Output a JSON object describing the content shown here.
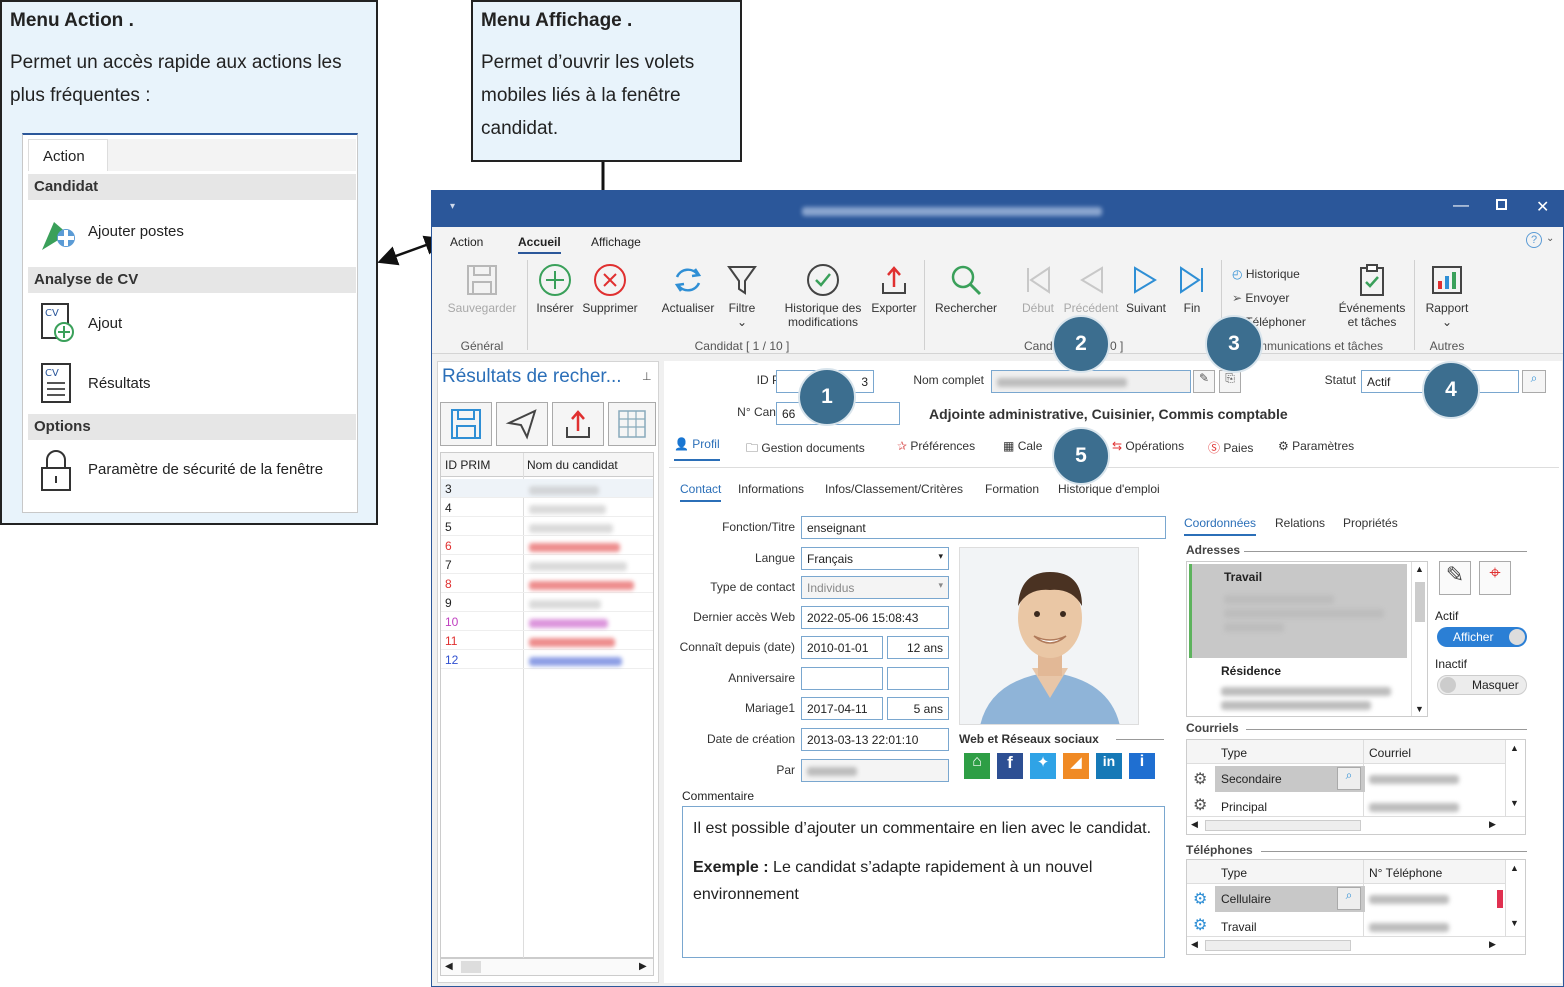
{
  "callout_action": {
    "title": "Menu Action .",
    "text": "Permet un accès rapide aux actions les plus fréquentes :",
    "tab_label": "Action",
    "sections": [
      {
        "header": "Candidat",
        "items": [
          "Ajouter postes"
        ]
      },
      {
        "header": "Analyse de CV",
        "items": [
          "Ajout",
          "Résultats"
        ]
      },
      {
        "header": "Options",
        "items": [
          "Paramètre de sécurité de la fenêtre"
        ]
      }
    ]
  },
  "callout_affichage": {
    "title": "Menu Affichage .",
    "text": "Permet d’ouvrir les volets mobiles liés à la fenêtre candidat."
  },
  "window": {
    "menu_tabs": [
      "Action",
      "Accueil",
      "Affichage"
    ],
    "active_tab": "Accueil",
    "ribbon": {
      "general": {
        "save": "Sauvegarder",
        "group": "Général"
      },
      "candidat": {
        "insert": "Insérer",
        "delete": "Supprimer",
        "refresh": "Actualiser",
        "filter": "Filtre",
        "history": "Historique des modifications",
        "export": "Exporter",
        "group": "Candidat [ 1 / 10 ]"
      },
      "nav": {
        "search": "Rechercher",
        "first": "Début",
        "prev": "Précédent",
        "next": "Suivant",
        "last": "Fin",
        "group": "Cand",
        "group_tail": "0 ]"
      },
      "comm": {
        "history": "Historique",
        "send": "Envoyer",
        "phone": "Téléphoner",
        "events": "Événements et tâches",
        "group": "mmunications et tâches"
      },
      "other": {
        "report": "Rapport",
        "group": "Autres"
      }
    },
    "left_panel": {
      "title": "Résultats de recher...",
      "col_id": "ID PRIM",
      "col_name": "Nom du candidat",
      "rows": [
        {
          "id": "3",
          "color": "#222"
        },
        {
          "id": "4",
          "color": "#222"
        },
        {
          "id": "5",
          "color": "#222"
        },
        {
          "id": "6",
          "color": "#e03030"
        },
        {
          "id": "7",
          "color": "#222"
        },
        {
          "id": "8",
          "color": "#e03030"
        },
        {
          "id": "9",
          "color": "#222"
        },
        {
          "id": "10",
          "color": "#c040c0"
        },
        {
          "id": "11",
          "color": "#e03030"
        },
        {
          "id": "12",
          "color": "#3050d0"
        }
      ]
    },
    "form": {
      "id_prim_label": "ID PRIM",
      "id_prim_value": "3",
      "num_label": "N° Candidat",
      "num_value": "66",
      "nom_label": "Nom complet",
      "statut_label": "Statut",
      "statut_value": "Actif",
      "postes": "Adjointe administrative, Cuisinier, Commis comptable",
      "subtabs": [
        "Profil",
        "Gestion documents",
        "Préférences",
        "Cale",
        "Opérations",
        "Paies",
        "Paramètres"
      ],
      "innertabs": [
        "Contact",
        "Informations",
        "Infos/Classement/Critères",
        "Formation",
        "Historique d'emploi"
      ],
      "fonction_label": "Fonction/Titre",
      "fonction_value": "enseignant",
      "langue_label": "Langue",
      "langue_value": "Français",
      "type_label": "Type de contact",
      "type_value": "Individus",
      "acces_label": "Dernier accès Web",
      "acces_value": "2022-05-06 15:08:43",
      "connait_label": "Connaît depuis (date)",
      "connait_value": "2010-01-01",
      "connait_years": "12 ans",
      "anniv_label": "Anniversaire",
      "mariage_label": "Mariage1",
      "mariage_value": "2017-04-11",
      "mariage_years": "5 ans",
      "creation_label": "Date de création",
      "creation_value": "2013-03-13 22:01:10",
      "par_label": "Par",
      "web_label": "Web et Réseaux sociaux",
      "comment_label": "Commentaire",
      "comment_line1": "Il est possible d’ajouter un commentaire en lien avec le candidat.",
      "comment_bold": "Exemple :",
      "comment_line2": " Le candidat s’adapte rapidement à un nouvel environnement"
    },
    "right": {
      "tabs": [
        "Coordonnées",
        "Relations",
        "Propriétés"
      ],
      "adresses": "Adresses",
      "addr1": "Travail",
      "addr2": "Résidence",
      "actif": "Actif",
      "afficher": "Afficher",
      "inactif": "Inactif",
      "masquer": "Masquer",
      "courriels": "Courriels",
      "col_type": "Type",
      "col_courriel": "Courriel",
      "email1": "Secondaire",
      "email2": "Principal",
      "telephones": "Téléphones",
      "col_tel": "N° Téléphone",
      "tel1": "Cellulaire",
      "tel2": "Travail"
    },
    "badges": [
      "1",
      "2",
      "3",
      "4",
      "5"
    ]
  }
}
